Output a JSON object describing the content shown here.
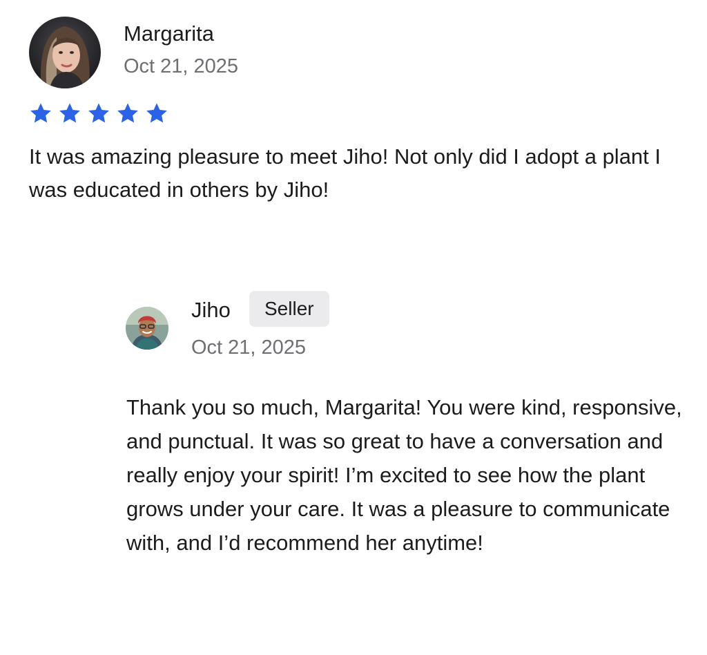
{
  "review": {
    "reviewer_name": "Margarita",
    "date": "Oct 21, 2025",
    "rating": 5,
    "rating_max": 5,
    "star_color": "#2b63e8",
    "text": "It was amazing pleasure to meet Jiho! Not only did I adopt a plant I was educated in others by Jiho!"
  },
  "reply": {
    "author_name": "Jiho",
    "badge": "Seller",
    "date": "Oct 21, 2025",
    "text": "Thank you so much, Margarita! You were kind, responsive, and punctual. It was so great to have a conversation and really enjoy your spirit! I’m excited to see how the plant grows under your care. It was a pleasure to communicate with, and I’d recommend her anytime!"
  }
}
